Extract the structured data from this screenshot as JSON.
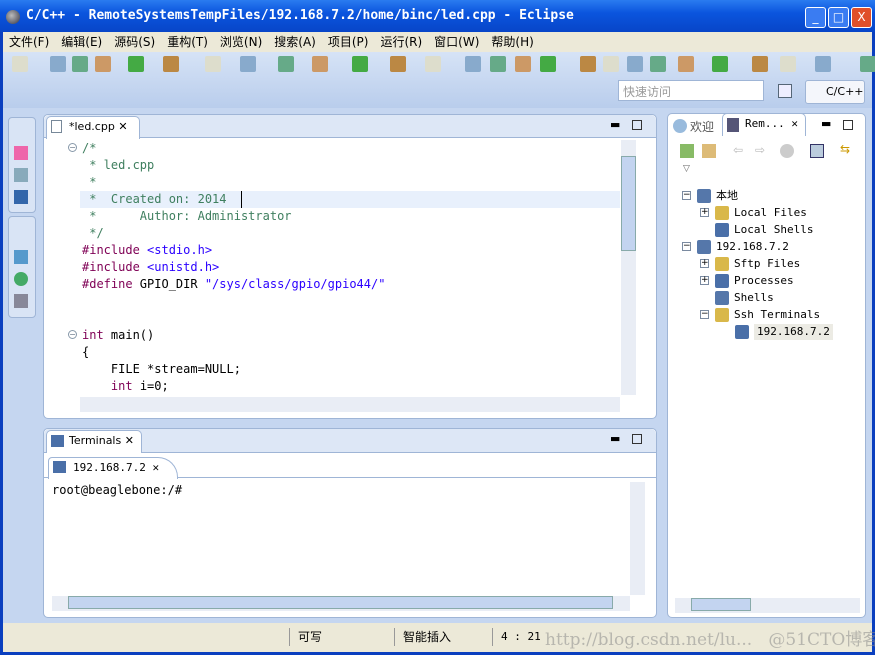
{
  "window": {
    "title": "C/C++ - RemoteSystemsTempFiles/192.168.7.2/home/binc/led.cpp - Eclipse",
    "minimize": "_",
    "maximize": "□",
    "close": "X"
  },
  "menu": [
    "文件(F)",
    "编辑(E)",
    "源码(S)",
    "重构(T)",
    "浏览(N)",
    "搜索(A)",
    "项目(P)",
    "运行(R)",
    "窗口(W)",
    "帮助(H)"
  ],
  "toolbar": {
    "quick_access_placeholder": "快速访问",
    "perspective": "C/C++"
  },
  "editor": {
    "tab": "*led.cpp",
    "lines": [
      {
        "t": "/*",
        "c": "cm"
      },
      {
        "t": " * led.cpp",
        "c": "cm"
      },
      {
        "t": " *",
        "c": "cm"
      },
      {
        "t": " *  Created on: 2014",
        "c": "cm"
      },
      {
        "t": " *      Author: Administrator",
        "c": "cm"
      },
      {
        "t": " */",
        "c": "cm"
      },
      {
        "t": "#include <stdio.h>",
        "c": "inc"
      },
      {
        "t": "#include <unistd.h>",
        "c": "inc"
      },
      {
        "t": "#define GPIO_DIR \"/sys/class/gpio/gpio44/\"",
        "c": "def"
      },
      {
        "t": "",
        "c": ""
      },
      {
        "t": "",
        "c": ""
      },
      {
        "t": "int main()",
        "c": "kw"
      },
      {
        "t": "{",
        "c": ""
      },
      {
        "t": "    FILE *stream=NULL;",
        "c": ""
      },
      {
        "t": "    int i=0;",
        "c": "kw"
      }
    ]
  },
  "terminals": {
    "view_tab": "Terminals",
    "session_tab": "192.168.7.2",
    "output": "root@beaglebone:/#"
  },
  "remote": {
    "tab_welcome": "欢迎",
    "tab_remote": "Rem...",
    "tree": [
      {
        "label": "本地",
        "depth": 0,
        "expander": "-"
      },
      {
        "label": "Local Files",
        "depth": 1,
        "expander": "+"
      },
      {
        "label": "Local Shells",
        "depth": 1,
        "expander": ""
      },
      {
        "label": "192.168.7.2",
        "depth": 0,
        "expander": "-"
      },
      {
        "label": "Sftp Files",
        "depth": 1,
        "expander": "+"
      },
      {
        "label": "Processes",
        "depth": 1,
        "expander": "+"
      },
      {
        "label": "Shells",
        "depth": 1,
        "expander": ""
      },
      {
        "label": "Ssh Terminals",
        "depth": 1,
        "expander": "-"
      },
      {
        "label": "192.168.7.2",
        "depth": 2,
        "expander": "",
        "selected": true
      }
    ]
  },
  "status": {
    "writable": "可写",
    "insert_mode": "智能插入",
    "position": "4 : 21",
    "watermark": "http://blog.csdn.net/lu...   @51CTO博客"
  }
}
